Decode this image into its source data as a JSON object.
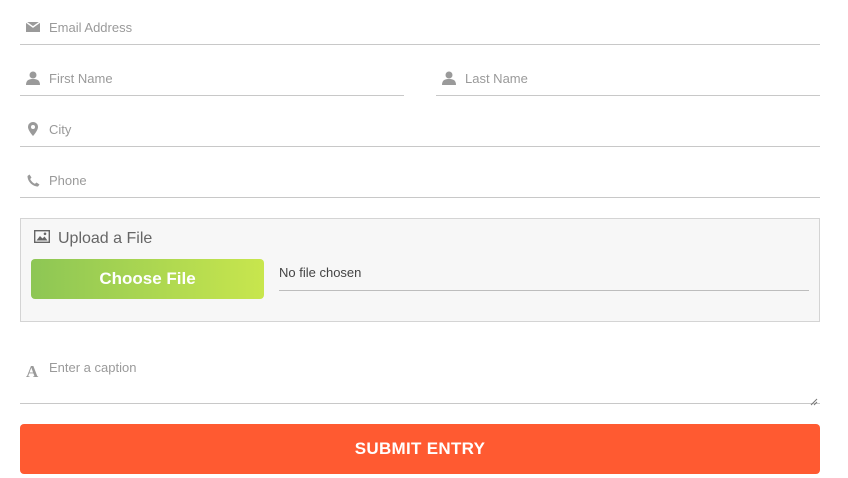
{
  "form": {
    "email": {
      "placeholder": "Email Address",
      "icon": "envelope-icon"
    },
    "first_name": {
      "placeholder": "First Name",
      "icon": "user-icon"
    },
    "last_name": {
      "placeholder": "Last Name",
      "icon": "user-icon"
    },
    "city": {
      "placeholder": "City",
      "icon": "map-marker-icon"
    },
    "phone": {
      "placeholder": "Phone",
      "icon": "phone-icon"
    },
    "upload": {
      "title": "Upload a File",
      "icon": "image-icon",
      "choose_label": "Choose File",
      "status": "No file chosen"
    },
    "caption": {
      "placeholder": "Enter a caption",
      "icon": "font-icon"
    },
    "submit_label": "SUBMIT ENTRY"
  },
  "colors": {
    "submit": "#ff5a31",
    "choose_gradient_start": "#8dc655",
    "choose_gradient_end": "#c8e64d",
    "icon": "#9a9a9a",
    "border": "#c8c8c8"
  }
}
